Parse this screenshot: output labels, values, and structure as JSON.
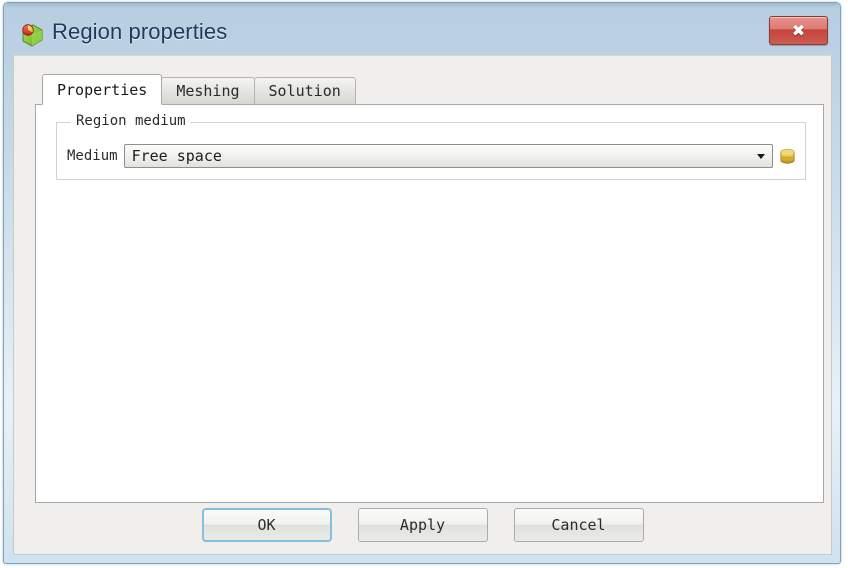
{
  "window": {
    "title": "Region properties",
    "icon": "region-properties-icon",
    "close_label": "✖"
  },
  "tabs": [
    {
      "label": "Properties",
      "active": true
    },
    {
      "label": "Meshing",
      "active": false
    },
    {
      "label": "Solution",
      "active": false
    }
  ],
  "properties_tab": {
    "group": {
      "title": "Region medium",
      "medium": {
        "label": "Medium",
        "value": "Free space",
        "arrow_icon": "chevron-down-icon",
        "browse_icon": "media-database-icon"
      }
    }
  },
  "buttons": [
    {
      "label": "OK",
      "default": true
    },
    {
      "label": "Apply",
      "default": false
    },
    {
      "label": "Cancel",
      "default": false
    }
  ],
  "colors": {
    "title_bar_start": "#b7cee1",
    "title_bar_end": "#cfe2ef",
    "title_text": "#1f3a5c",
    "close_button_red": "#c4453c",
    "client_background": "#f0efed",
    "panel_background": "#ffffff",
    "focus_border": "#82c0de",
    "browse_icon_gold": "#d8b227"
  }
}
